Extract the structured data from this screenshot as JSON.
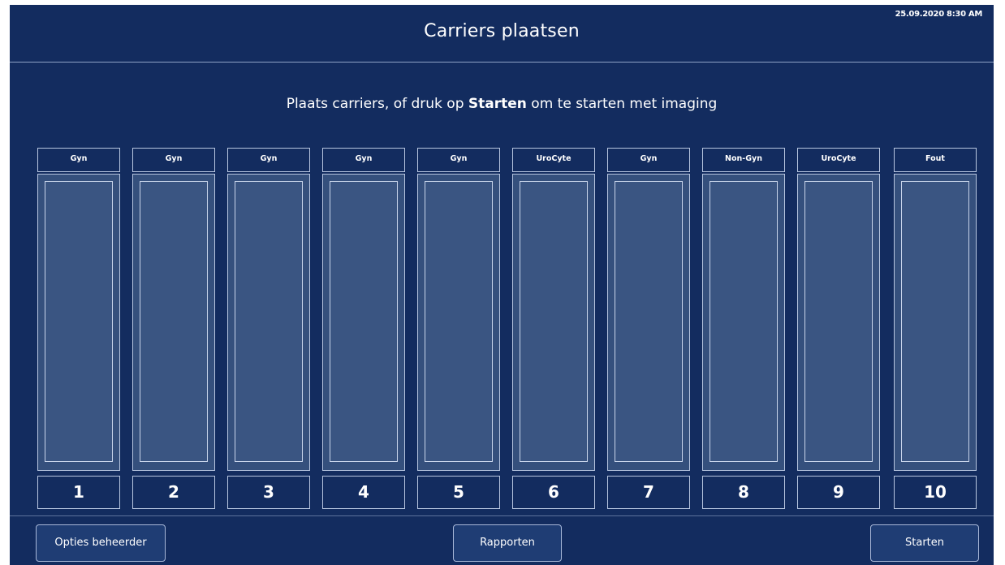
{
  "header": {
    "title": "Carriers plaatsen",
    "datetime": "25.09.2020 8:30 AM"
  },
  "instruction": {
    "before": "Plaats carriers, of druk op ",
    "bold": "Starten",
    "after": " om te starten met imaging"
  },
  "carriers": [
    {
      "label": "Gyn",
      "number": "1"
    },
    {
      "label": "Gyn",
      "number": "2"
    },
    {
      "label": "Gyn",
      "number": "3"
    },
    {
      "label": "Gyn",
      "number": "4"
    },
    {
      "label": "Gyn",
      "number": "5"
    },
    {
      "label": "UroCyte",
      "number": "6"
    },
    {
      "label": "Gyn",
      "number": "7"
    },
    {
      "label": "Non-Gyn",
      "number": "8"
    },
    {
      "label": "UroCyte",
      "number": "9"
    },
    {
      "label": "Fout",
      "number": "10"
    }
  ],
  "footer": {
    "opties_label": "Opties beheerder",
    "rapporten_label": "Rapporten",
    "starten_label": "Starten"
  },
  "colors": {
    "background": "#132c5f",
    "carrier_body": "#35507d",
    "button": "#1f3d74"
  }
}
